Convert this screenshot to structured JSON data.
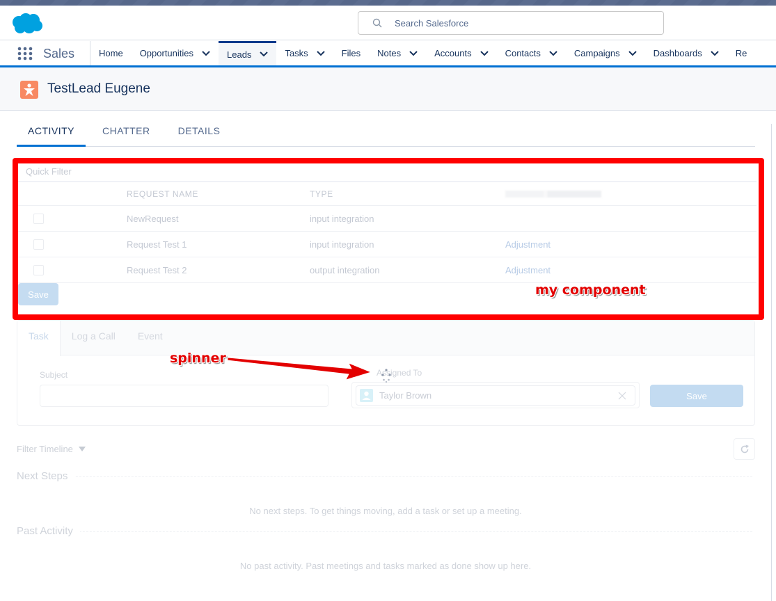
{
  "header": {
    "search_placeholder": "Search Salesforce",
    "logo": "salesforce-cloud-logo"
  },
  "nav": {
    "app_name": "Sales",
    "items": [
      {
        "label": "Home",
        "has_menu": false
      },
      {
        "label": "Opportunities",
        "has_menu": true
      },
      {
        "label": "Leads",
        "has_menu": true,
        "active": true
      },
      {
        "label": "Tasks",
        "has_menu": true
      },
      {
        "label": "Files",
        "has_menu": false
      },
      {
        "label": "Notes",
        "has_menu": true
      },
      {
        "label": "Accounts",
        "has_menu": true
      },
      {
        "label": "Contacts",
        "has_menu": true
      },
      {
        "label": "Campaigns",
        "has_menu": true
      },
      {
        "label": "Dashboards",
        "has_menu": true
      },
      {
        "label": "Re",
        "has_menu": false
      }
    ]
  },
  "record": {
    "title": "TestLead Eugene",
    "icon": "lead-icon"
  },
  "tabs": [
    {
      "label": "ACTIVITY",
      "active": true
    },
    {
      "label": "CHATTER"
    },
    {
      "label": "DETAILS"
    }
  ],
  "component": {
    "quick_filter_placeholder": "Quick Filter",
    "columns": [
      "REQUEST NAME",
      "TYPE",
      ""
    ],
    "rows": [
      {
        "name": "NewRequest",
        "type": "input integration",
        "third": ""
      },
      {
        "name": "Request Test 1",
        "type": "input integration",
        "third": "Adjustment"
      },
      {
        "name": "Request Test 2",
        "type": "output integration",
        "third": "Adjustment"
      }
    ],
    "save_label": "Save"
  },
  "annotations": {
    "component_label": "my component",
    "spinner_label": "spinner",
    "box_color": "#ff0000"
  },
  "publisher": {
    "tabs": [
      {
        "label": "Task",
        "active": true
      },
      {
        "label": "Log a Call"
      },
      {
        "label": "Event"
      }
    ],
    "subject_label": "Subject",
    "subject_value": "",
    "assigned_label": "Assigned To",
    "assigned_value": "Taylor Brown",
    "save_label": "Save"
  },
  "timeline": {
    "filter_label": "Filter Timeline",
    "next_steps_title": "Next Steps",
    "next_steps_empty": "No next steps. To get things moving, add a task or set up a meeting.",
    "past_activity_title": "Past Activity",
    "past_activity_empty": "No past activity. Past meetings and tasks marked as done show up here."
  },
  "colors": {
    "brand_blue": "#0070d2",
    "lead_orange": "#f88962",
    "annotation_red": "#ff0000"
  }
}
